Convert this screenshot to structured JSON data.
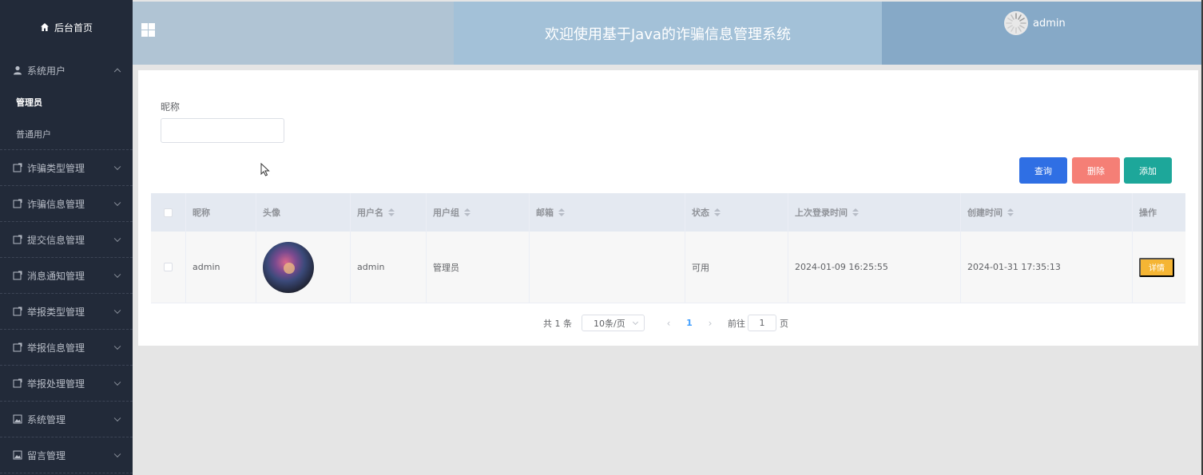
{
  "sidebar": {
    "home": "后台首页",
    "groups": [
      {
        "label": "系统用户",
        "icon": "user-icon",
        "expanded": true,
        "children": [
          "管理员",
          "普通用户"
        ],
        "active_child": "管理员"
      },
      {
        "label": "诈骗类型管理",
        "icon": "folder-icon"
      },
      {
        "label": "诈骗信息管理",
        "icon": "folder-icon"
      },
      {
        "label": "提交信息管理",
        "icon": "folder-icon"
      },
      {
        "label": "消息通知管理",
        "icon": "folder-icon"
      },
      {
        "label": "举报类型管理",
        "icon": "folder-icon"
      },
      {
        "label": "举报信息管理",
        "icon": "folder-icon"
      },
      {
        "label": "举报处理管理",
        "icon": "folder-icon"
      },
      {
        "label": "系统管理",
        "icon": "image-icon"
      },
      {
        "label": "留言管理",
        "icon": "image-icon"
      }
    ]
  },
  "header": {
    "title": "欢迎使用基于Java的诈骗信息管理系统",
    "username": "admin"
  },
  "filter": {
    "nickname_label": "昵称",
    "nickname_value": "",
    "nickname_placeholder": ""
  },
  "buttons": {
    "query": "查询",
    "delete": "删除",
    "add": "添加"
  },
  "table": {
    "columns": [
      "昵称",
      "头像",
      "用户名",
      "用户组",
      "邮箱",
      "状态",
      "上次登录时间",
      "创建时间",
      "操作"
    ],
    "rows": [
      {
        "nickname": "admin",
        "username": "admin",
        "group": "管理员",
        "email": "",
        "status": "可用",
        "last_login": "2024-01-09 16:25:55",
        "created": "2024-01-31 17:35:13",
        "action": "详情"
      }
    ]
  },
  "pagination": {
    "total": "共 1 条",
    "page_size": "10条/页",
    "current_page": "1",
    "goto_label": "前往",
    "goto_value": "1",
    "page_suffix": "页"
  },
  "colors": {
    "sidebar_bg": "#222a39",
    "primary": "#2f6fe4",
    "danger": "#f57f76",
    "success": "#1da79a",
    "warning": "#f5b534"
  }
}
